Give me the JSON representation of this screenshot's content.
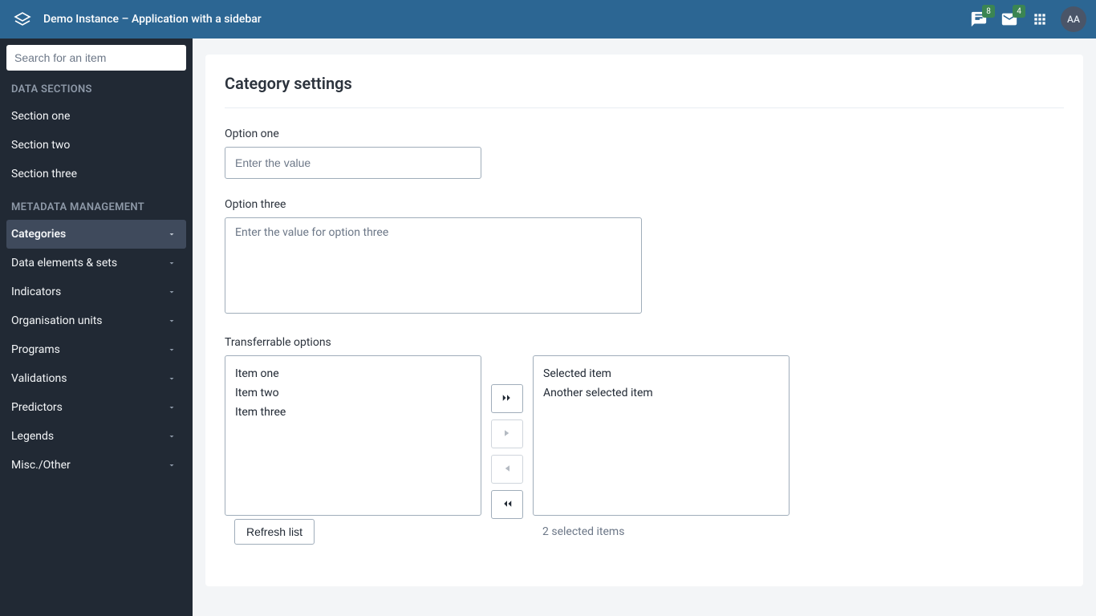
{
  "header": {
    "title": "Demo Instance – Application with a sidebar",
    "messages_badge": "8",
    "mail_badge": "4",
    "avatar_initials": "AA"
  },
  "sidebar": {
    "search_placeholder": "Search for an item",
    "groups": [
      {
        "heading": "DATA SECTIONS",
        "links": [
          {
            "label": "Section one"
          },
          {
            "label": "Section two"
          },
          {
            "label": "Section three"
          }
        ]
      },
      {
        "heading": "METADATA MANAGEMENT",
        "parents": [
          {
            "label": "Categories",
            "active": true
          },
          {
            "label": "Data elements & sets"
          },
          {
            "label": "Indicators"
          },
          {
            "label": "Organisation units"
          },
          {
            "label": "Programs"
          },
          {
            "label": "Validations"
          },
          {
            "label": "Predictors"
          },
          {
            "label": "Legends"
          },
          {
            "label": "Misc./Other"
          }
        ]
      }
    ]
  },
  "page": {
    "title": "Category settings",
    "option_one": {
      "label": "Option one",
      "placeholder": "Enter the value"
    },
    "option_three": {
      "label": "Option three",
      "placeholder": "Enter the value for option three"
    },
    "transfer": {
      "label": "Transferrable options",
      "source": [
        "Item one",
        "Item two",
        "Item three"
      ],
      "picked": [
        "Selected item",
        "Another selected item"
      ],
      "refresh_label": "Refresh list",
      "status": "2 selected items"
    }
  }
}
